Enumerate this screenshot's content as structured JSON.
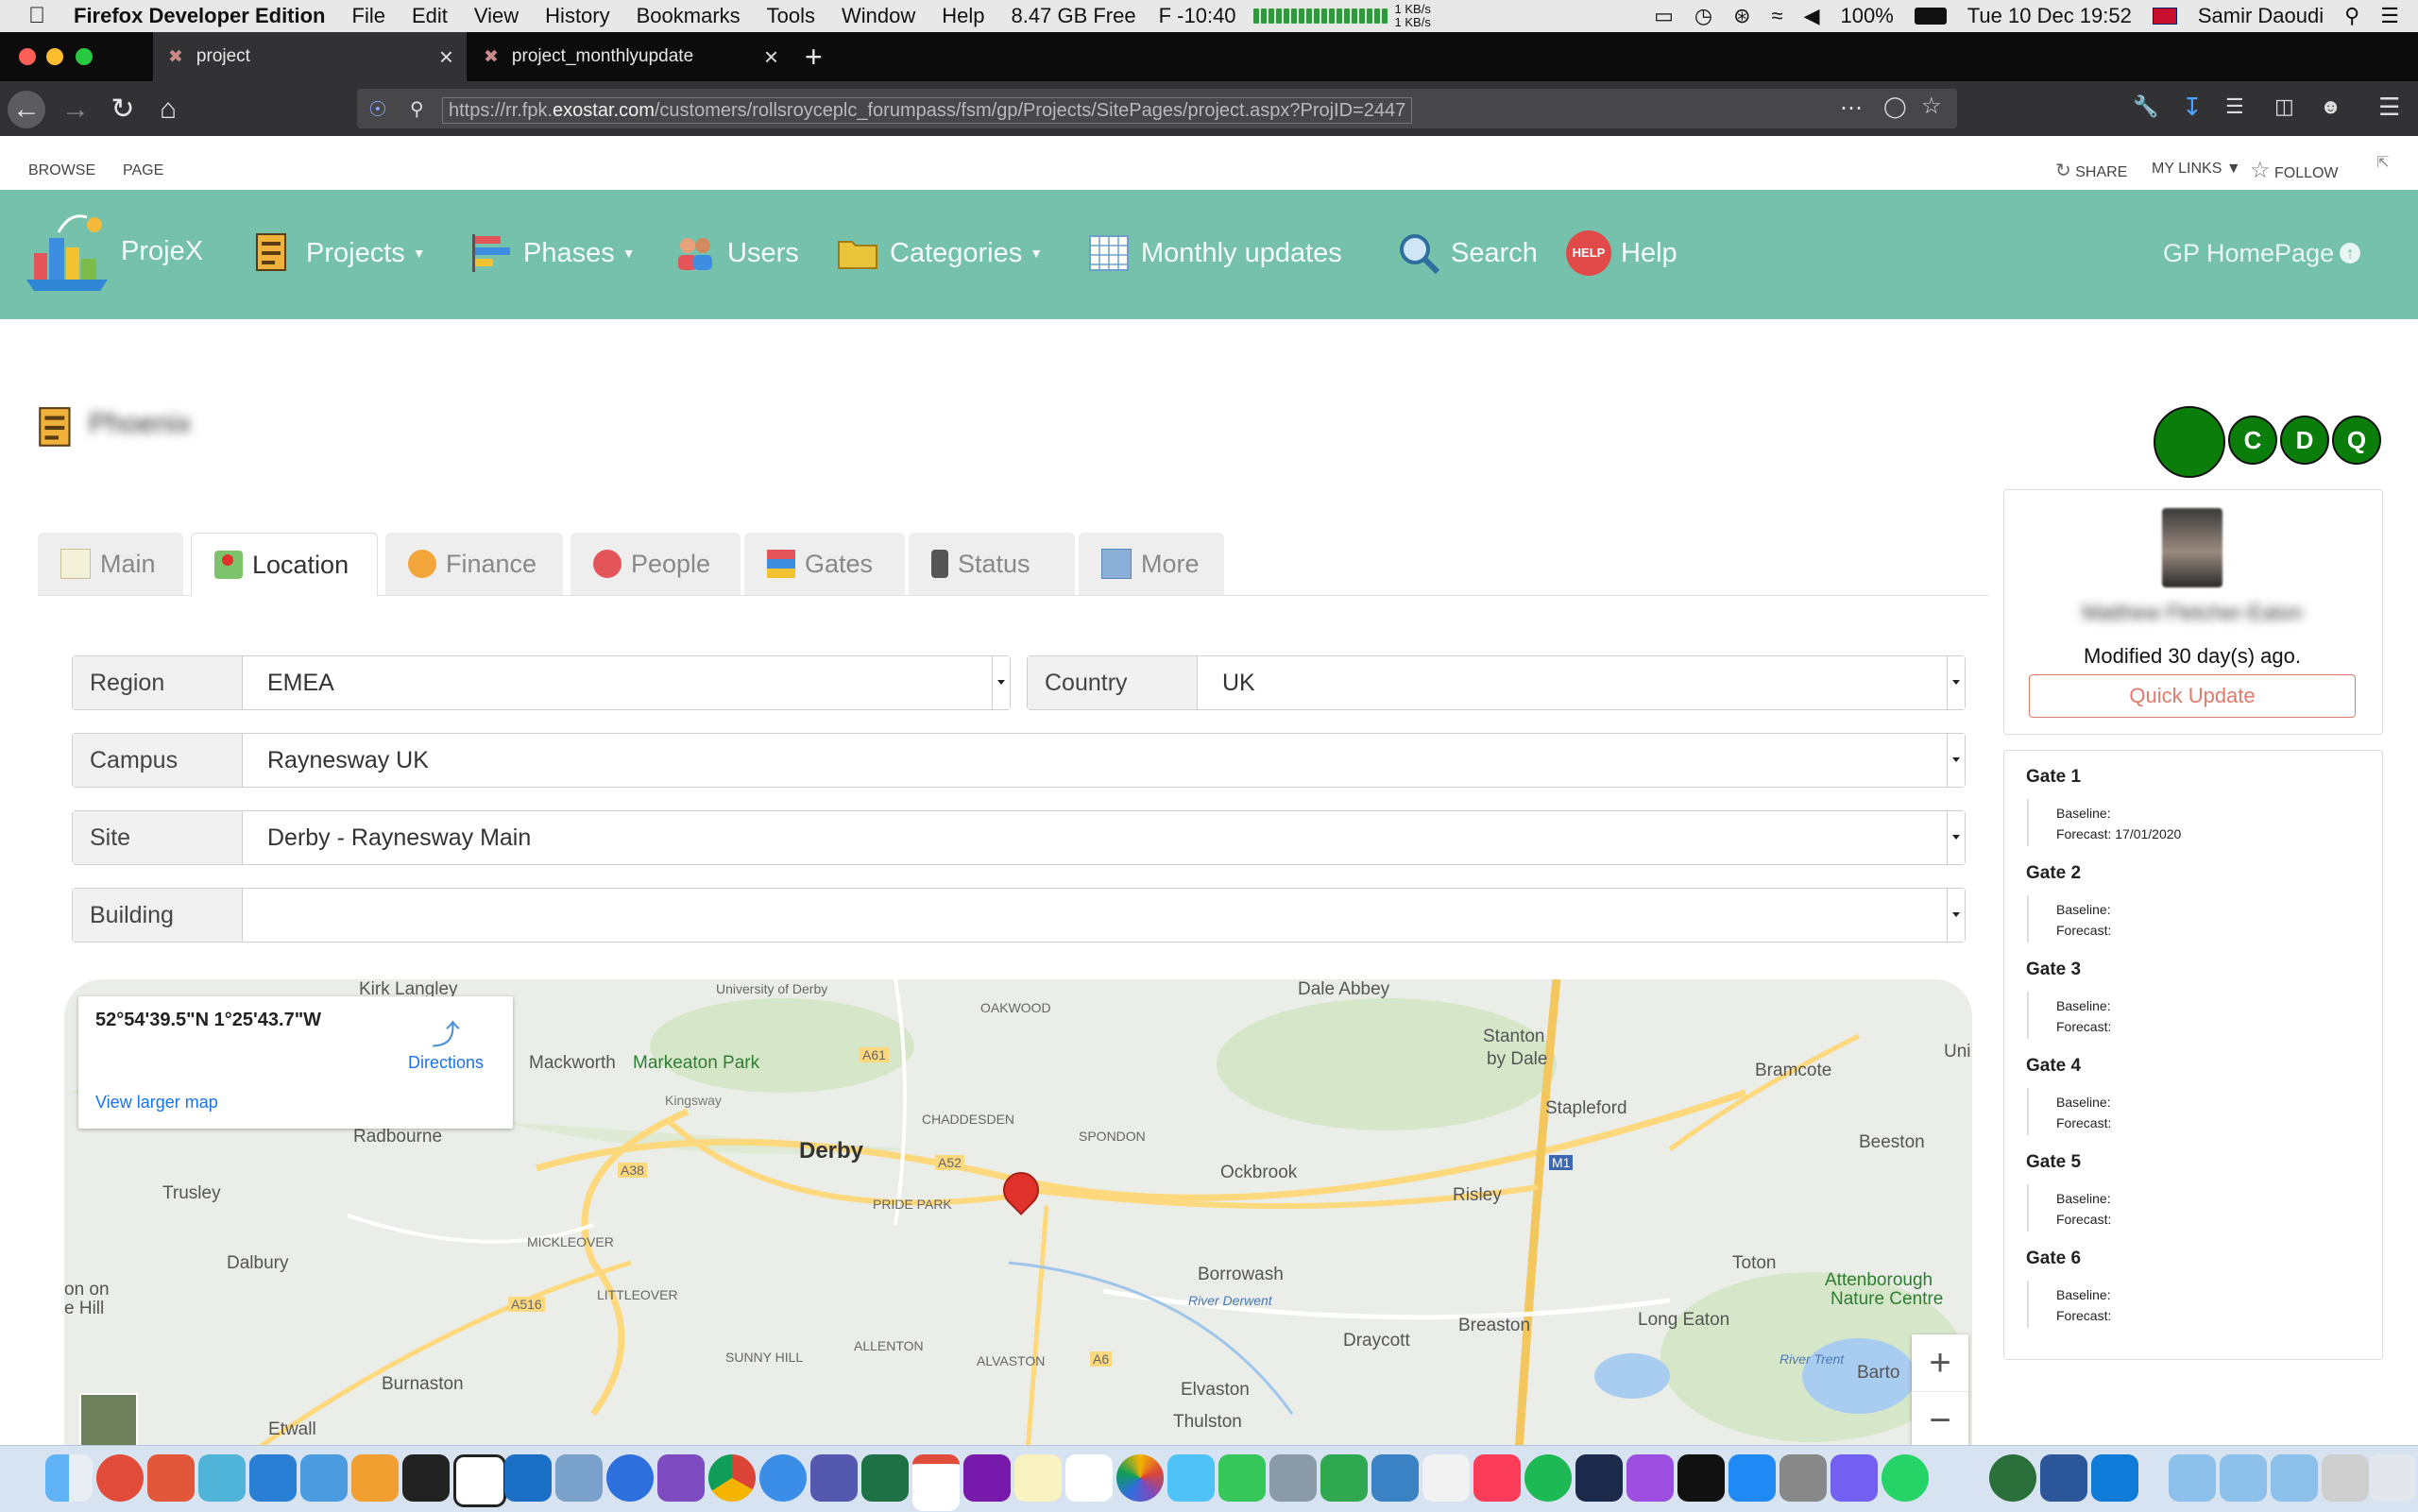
{
  "menubar": {
    "app": "Firefox Developer Edition",
    "menus": [
      "File",
      "Edit",
      "View",
      "History",
      "Bookmarks",
      "Tools",
      "Window",
      "Help"
    ],
    "disk_free": "8.47 GB Free",
    "temp": "F -10:40",
    "net_up": "1 KB/s",
    "net_down": "1 KB/s",
    "battery": "100%",
    "datetime": "Tue 10 Dec  19:52",
    "user": "Samir Daoudi"
  },
  "browser": {
    "tabs": [
      {
        "title": "project"
      },
      {
        "title": "project_monthlyupdate"
      }
    ],
    "url_prefix": "https://rr.fpk.",
    "url_domain": "exostar.com",
    "url_path": "/customers/rollsroyceplc_forumpass/fsm/gp/Projects/SitePages/project.aspx?ProjID=2447"
  },
  "ribbon": {
    "browse": "BROWSE",
    "page": "PAGE",
    "share": "SHARE",
    "my_links": "MY LINKS",
    "follow": "FOLLOW"
  },
  "nav": {
    "brand": "ProjeX",
    "projects": "Projects",
    "phases": "Phases",
    "users": "Users",
    "categories": "Categories",
    "monthly_updates": "Monthly updates",
    "search": "Search",
    "help": "Help",
    "help_badge": "HELP",
    "homepage": "GP HomePage"
  },
  "project": {
    "name": "Phoenix",
    "status_letters": [
      "C",
      "D",
      "Q"
    ]
  },
  "tabs": [
    {
      "label": "Main"
    },
    {
      "label": "Location"
    },
    {
      "label": "Finance"
    },
    {
      "label": "People"
    },
    {
      "label": "Gates"
    },
    {
      "label": "Status"
    },
    {
      "label": "More"
    }
  ],
  "location": {
    "region": {
      "label": "Region",
      "value": "EMEA"
    },
    "country": {
      "label": "Country",
      "value": "UK"
    },
    "campus": {
      "label": "Campus",
      "value": "Raynesway UK"
    },
    "site": {
      "label": "Site",
      "value": "Derby - Raynesway Main"
    },
    "building": {
      "label": "Building",
      "value": ""
    }
  },
  "map": {
    "coords": "52°54'39.5\"N 1°25'43.7\"W",
    "directions": "Directions",
    "larger": "View larger map",
    "labels": {
      "kirk_langley": "Kirk Langley",
      "univ_derby": "University of Derby",
      "dale_abbey": "Dale Abbey",
      "oakwood": "OAKWOOD",
      "stanton": "Stanton",
      "by_dale": "by Dale",
      "bramcote": "Bramcote",
      "mackworth": "Mackworth",
      "markeaton": "Markeaton Park",
      "stapleford": "Stapleford",
      "chaddesden": "CHADDESDEN",
      "spondon": "SPONDON",
      "radbourne": "Radbourne",
      "derby": "Derby",
      "beeston": "Beeston",
      "trusley": "Trusley",
      "pride_park": "PRIDE PARK",
      "ockbrook": "Ockbrook",
      "risley": "Risley",
      "mickleover": "MICKLEOVER",
      "dalbury": "Dalbury",
      "borrowash": "Borrowash",
      "toton": "Toton",
      "attenborough": "Attenborough",
      "nature_centre": "Nature Centre",
      "littleover": "LITTLEOVER",
      "river_derwent": "River Derwent",
      "breaston": "Breaston",
      "long_eaton": "Long Eaton",
      "sunny_hill": "SUNNY HILL",
      "allenton": "ALLENTON",
      "draycott": "Draycott",
      "burnaston": "Burnaston",
      "alvaston": "ALVASTON",
      "elvaston": "Elvaston",
      "river_trent": "River Trent",
      "barton": "Barto",
      "etwall": "Etwall",
      "thulston": "Thulston",
      "on_on": "on on",
      "e_hill": "e Hill",
      "uni": "Uni"
    },
    "roads": {
      "a52": "A52",
      "a61": "A61",
      "a38": "A38",
      "a516": "A516",
      "a6": "A6",
      "m1": "M1",
      "kingsway": "Kingsway"
    }
  },
  "side": {
    "author": "Matthew Fletcher-Eaton",
    "modified": "Modified 30 day(s) ago.",
    "quick_update": "Quick Update",
    "gates": [
      {
        "name": "Gate 1",
        "baseline": "Baseline:",
        "forecast": "Forecast: 17/01/2020"
      },
      {
        "name": "Gate 2",
        "baseline": "Baseline:",
        "forecast": "Forecast:"
      },
      {
        "name": "Gate 3",
        "baseline": "Baseline:",
        "forecast": "Forecast:"
      },
      {
        "name": "Gate 4",
        "baseline": "Baseline:",
        "forecast": "Forecast:"
      },
      {
        "name": "Gate 5",
        "baseline": "Baseline:",
        "forecast": "Forecast:"
      },
      {
        "name": "Gate 6",
        "baseline": "Baseline:",
        "forecast": "Forecast:"
      }
    ]
  },
  "colors": {
    "nav_bg": "#75c1ab",
    "status_green": "#0b7d0b",
    "quick_update": "#e07a6a",
    "map_pin": "#e0322a"
  }
}
